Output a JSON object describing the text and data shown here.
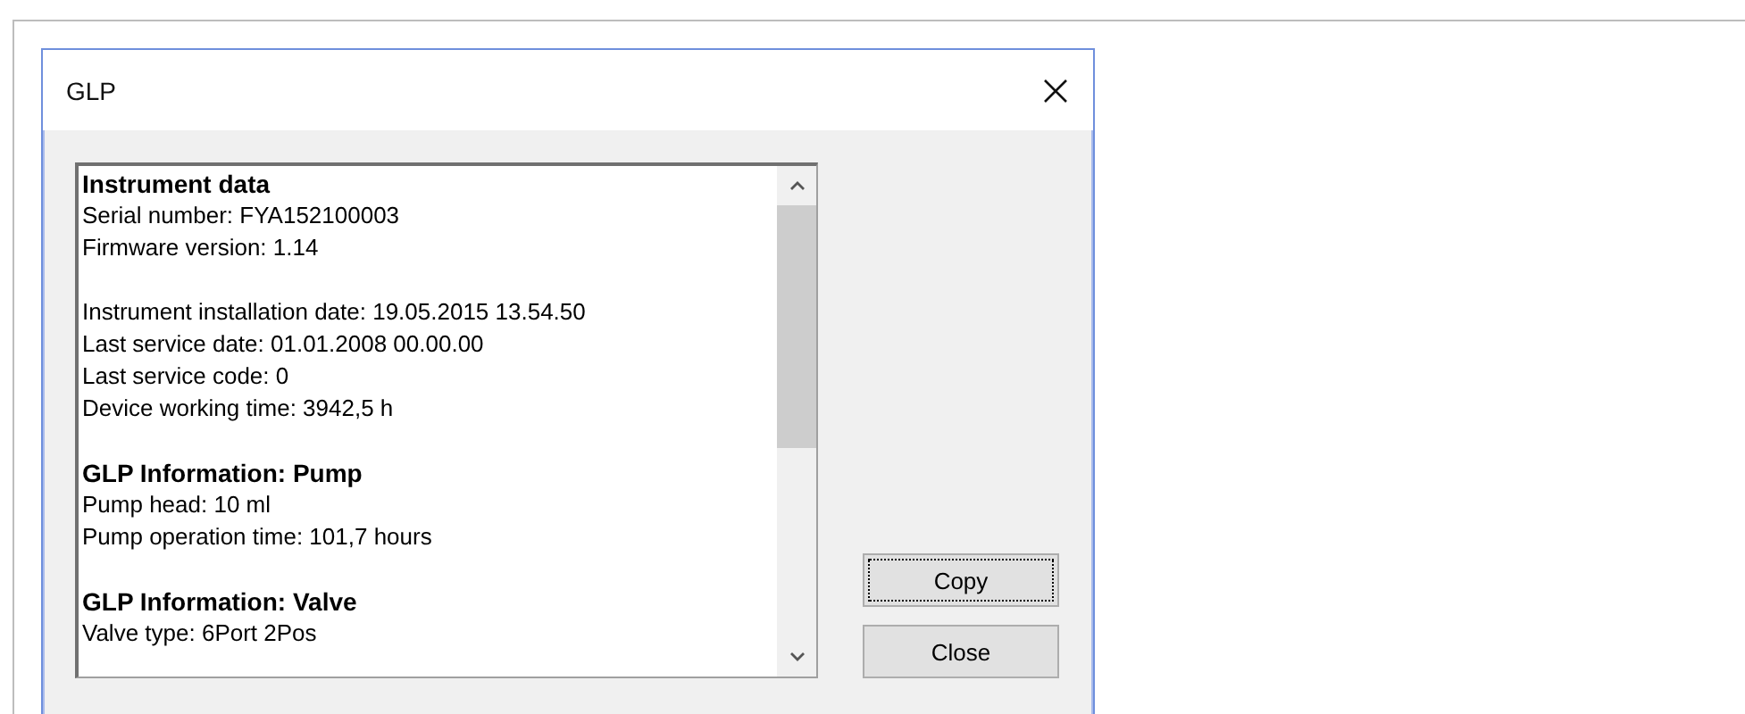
{
  "window": {
    "title": "GLP"
  },
  "info_sections": [
    {
      "heading": "Instrument data",
      "paragraphs": [
        [
          "Serial number: FYA152100003",
          "Firmware version: 1.14"
        ],
        [
          "Instrument installation date: 19.05.2015 13.54.50",
          "Last service date: 01.01.2008 00.00.00",
          "Last service code: 0",
          "Device working time: 3942,5 h"
        ]
      ]
    },
    {
      "heading": "GLP Information: Pump",
      "paragraphs": [
        [
          "Pump head: 10 ml",
          "Pump operation time: 101,7 hours"
        ]
      ]
    },
    {
      "heading": "GLP Information: Valve",
      "paragraphs": [
        [
          "Valve type: 6Port 2Pos"
        ]
      ]
    }
  ],
  "buttons": [
    {
      "label": "Copy",
      "focused": true
    },
    {
      "label": "Close",
      "focused": false
    }
  ]
}
